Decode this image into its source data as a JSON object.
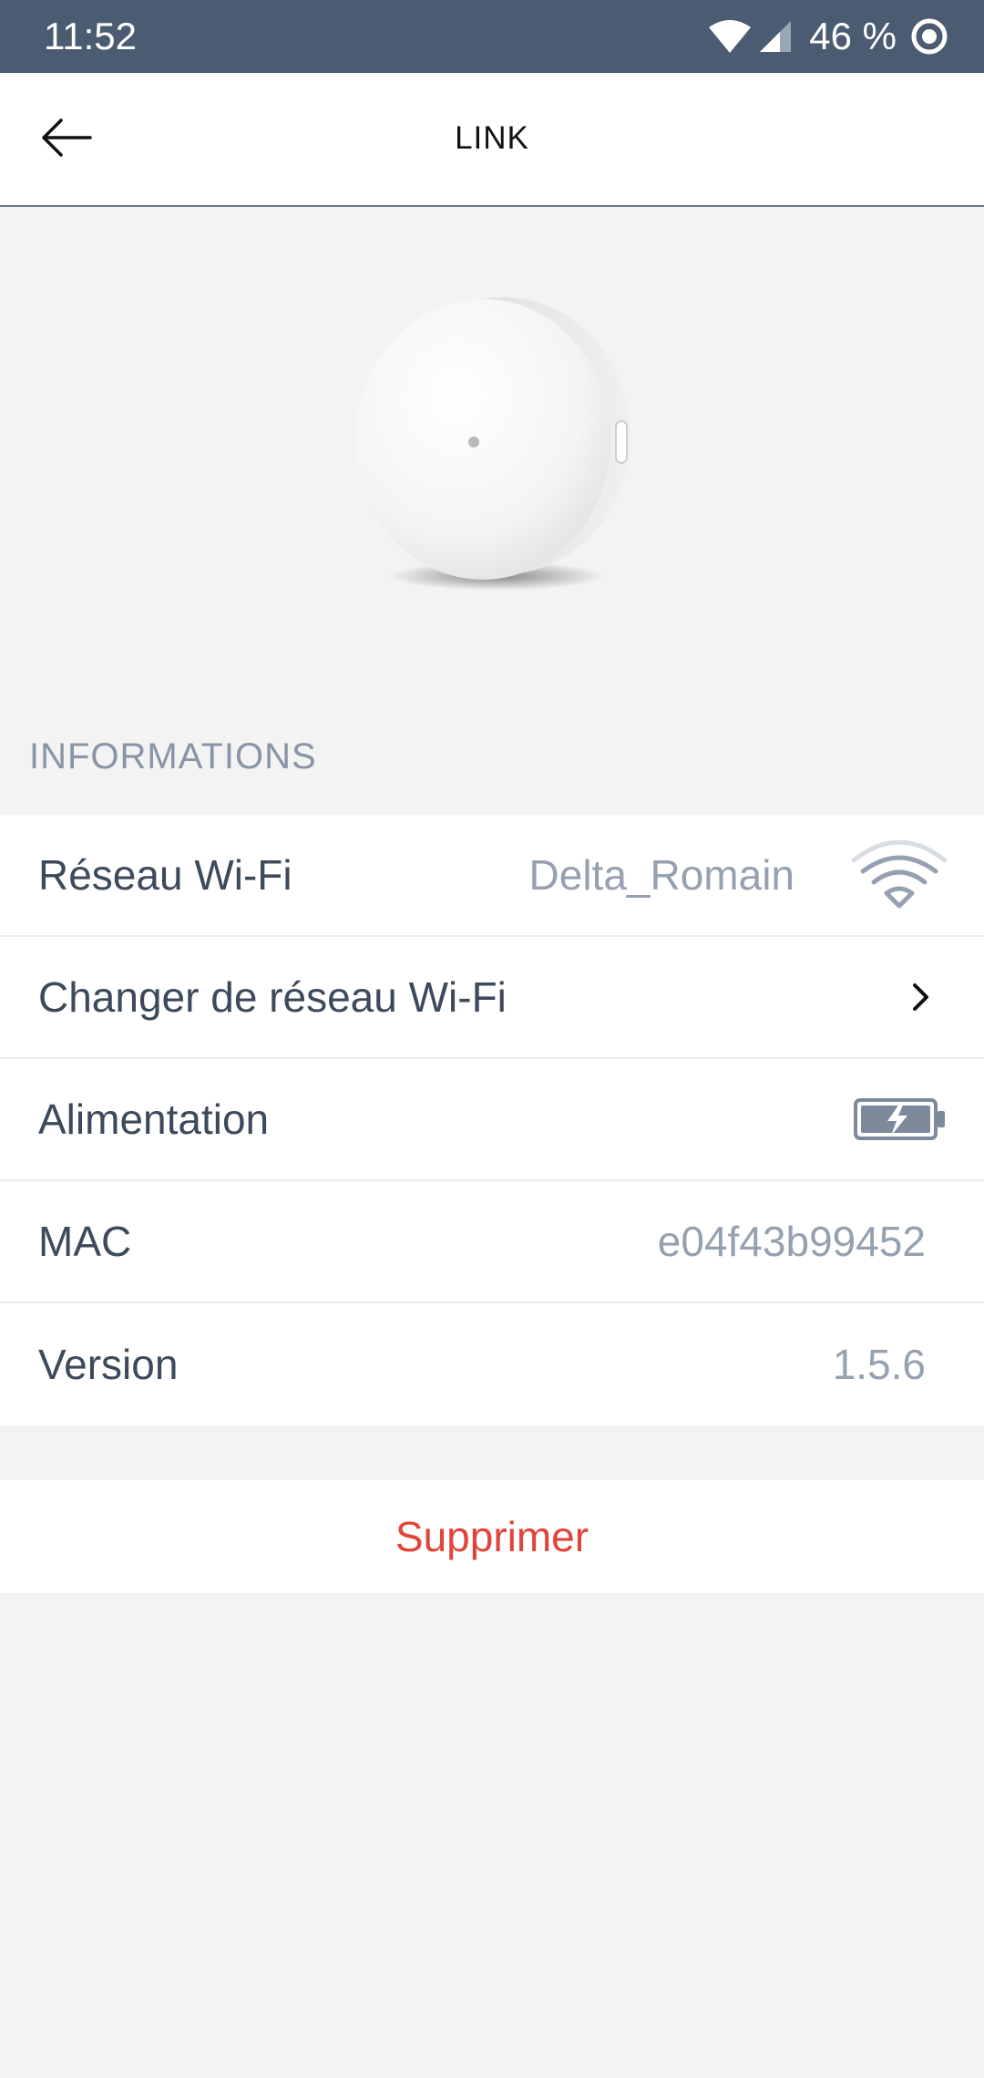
{
  "status_bar": {
    "time": "11:52",
    "battery_percent": "46 %",
    "icons": [
      "wifi-icon",
      "cell-signal-icon",
      "battery-saver-icon"
    ]
  },
  "header": {
    "title": "LINK",
    "back_icon": "arrow-left-icon"
  },
  "device": {
    "image": "round-white-hub-device"
  },
  "informations": {
    "section_title": "INFORMATIONS",
    "wifi": {
      "label": "Réseau Wi-Fi",
      "value": "Delta_Romain",
      "icon": "wifi-signal-icon"
    },
    "change_wifi": {
      "label": "Changer de réseau Wi-Fi",
      "icon": "chevron-right-icon"
    },
    "power": {
      "label": "Alimentation",
      "icon": "battery-charging-icon"
    },
    "mac": {
      "label": "MAC",
      "value": "e04f43b99452"
    },
    "version": {
      "label": "Version",
      "value": "1.5.6"
    }
  },
  "actions": {
    "delete_label": "Supprimer"
  },
  "colors": {
    "status_bar": "#4a5b72",
    "background": "#f3f3f3",
    "label_text": "#3c4a5c",
    "value_text": "#96a1b0",
    "delete_text": "#e1453a"
  }
}
